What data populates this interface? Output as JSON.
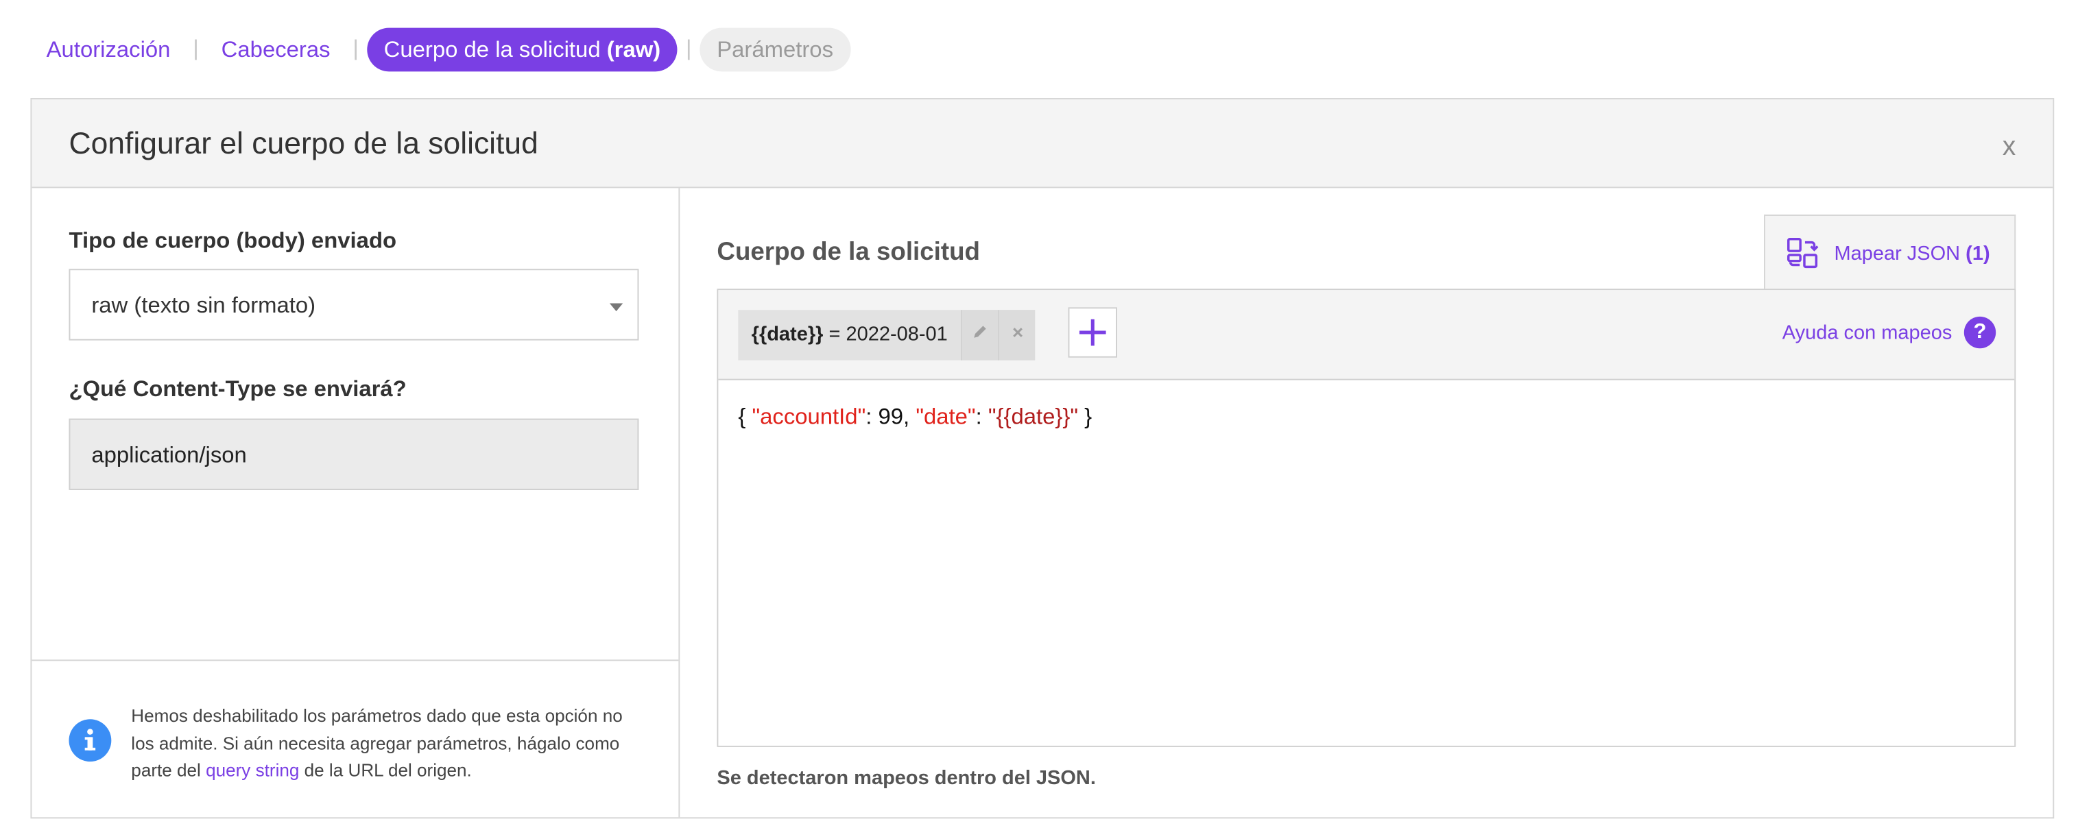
{
  "tabs": [
    {
      "label": "Autorización",
      "state": "link"
    },
    {
      "label": "Cabeceras",
      "state": "link"
    },
    {
      "label": "Cuerpo de la solicitud",
      "bold_suffix": "(raw)",
      "state": "active"
    },
    {
      "label": "Parámetros",
      "state": "disabled"
    }
  ],
  "tab_separator": "|",
  "panel": {
    "title": "Configurar el cuerpo de la solicitud",
    "close_label": "x"
  },
  "left": {
    "body_type_label": "Tipo de cuerpo (body) enviado",
    "body_type_value": "raw (texto sin formato)",
    "content_type_label": "¿Qué Content-Type se enviará?",
    "content_type_value": "application/json",
    "info": {
      "text_before": "Hemos deshabilitado los parámetros dado que esta opción no los admite. Si aún necesita agregar parámetros, hágalo como parte del ",
      "link": "query string",
      "text_after": " de la URL del origen."
    }
  },
  "right": {
    "section_title": "Cuerpo de la solicitud",
    "map_button": {
      "label": "Mapear JSON",
      "count": "(1)"
    },
    "mapping_chip": {
      "variable": "{{date}}",
      "assignment": "= 2022-08-01"
    },
    "help_label": "Ayuda con mapeos",
    "help_icon_glyph": "?",
    "code": {
      "open": "{ ",
      "key1": "\"accountId\"",
      "sep1": ": 99, ",
      "key2": "\"date\"",
      "sep2": ": ",
      "val2": "\"{{date}}\"",
      "close": " }"
    },
    "detected_note": "Se detectaron mapeos dentro del JSON."
  },
  "colors": {
    "accent": "#7a3fe4",
    "info_blue": "#3b8ef5",
    "json_key": "#e0221b",
    "json_string": "#b01c1c"
  }
}
